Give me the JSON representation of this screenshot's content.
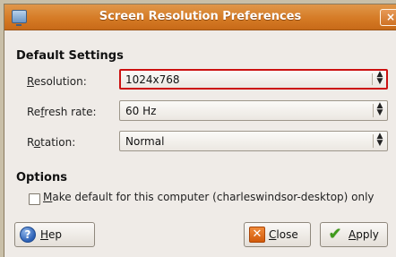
{
  "window": {
    "title": "Screen Resolution Preferences",
    "close_glyph": "×"
  },
  "default_settings": {
    "heading": "Default Settings",
    "resolution": {
      "label_mnemonic": "R",
      "label_rest": "esolution:",
      "value": "1024x768"
    },
    "refresh_rate": {
      "label_pre": "Re",
      "label_mnemonic": "f",
      "label_rest": "resh rate:",
      "value": "60 Hz"
    },
    "rotation": {
      "label_pre": "R",
      "label_mnemonic": "o",
      "label_rest": "tation:",
      "value": "Normal"
    }
  },
  "options": {
    "heading": "Options",
    "make_default": {
      "label_mnemonic": "M",
      "label_rest": "ake default for this computer (charleswindsor-desktop) only",
      "checked": false
    }
  },
  "buttons": {
    "help": {
      "label_mnemonic": "H",
      "label_rest": "ep",
      "icon": "help-icon"
    },
    "close": {
      "label_mnemonic": "C",
      "label_rest": "lose",
      "icon": "close-icon"
    },
    "apply": {
      "label_mnemonic": "A",
      "label_rest": "pply",
      "icon": "apply-check-icon"
    }
  },
  "colors": {
    "titlebar": "#d57b26",
    "focus_ring": "#cc1111",
    "window_bg": "#efebe7"
  }
}
